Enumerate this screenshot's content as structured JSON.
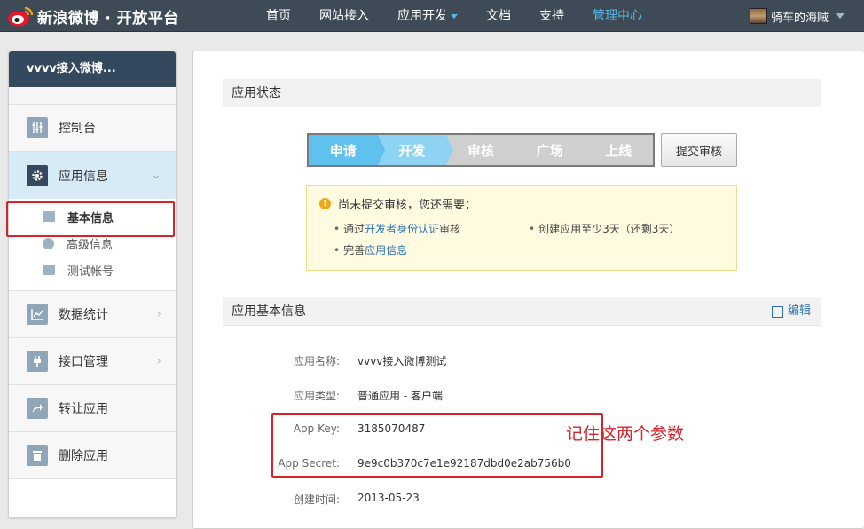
{
  "topbar": {
    "logo_text": "新浪微博 · 开放平台",
    "nav": [
      {
        "label": "首页"
      },
      {
        "label": "网站接入"
      },
      {
        "label": "应用开发"
      },
      {
        "label": "文档"
      },
      {
        "label": "支持"
      },
      {
        "label": "管理中心"
      }
    ],
    "user_name": "骑车的海贼"
  },
  "sidebar": {
    "app_name": "vvvv接入微博...",
    "items": [
      {
        "label": "控制台",
        "icon": "dashboard-icon"
      },
      {
        "label": "应用信息",
        "icon": "gear-icon"
      },
      {
        "label": "数据统计",
        "icon": "chart-icon"
      },
      {
        "label": "接口管理",
        "icon": "plug-icon"
      },
      {
        "label": "转让应用",
        "icon": "share-icon"
      },
      {
        "label": "删除应用",
        "icon": "trash-icon"
      }
    ],
    "sub_items": [
      {
        "label": "基本信息",
        "icon": "card-icon"
      },
      {
        "label": "高级信息",
        "icon": "alert-icon"
      },
      {
        "label": "测试帐号",
        "icon": "user-card-icon"
      }
    ]
  },
  "main": {
    "status_title": "应用状态",
    "steps": [
      {
        "label": "申请",
        "state": "done"
      },
      {
        "label": "开发",
        "state": "current"
      },
      {
        "label": "审核",
        "state": "pending"
      },
      {
        "label": "广场",
        "state": "pending"
      },
      {
        "label": "上线",
        "state": "pending"
      }
    ],
    "submit_label": "提交审核",
    "notice": {
      "title": "尚未提交审核，您还需要：",
      "line1_prefix": "通过",
      "line1_link": "开发者身份认证",
      "line1_suffix": "审核",
      "line2": "创建应用至少3天（还剩3天）",
      "line3_prefix": "完善",
      "line3_link": "应用信息"
    },
    "basic_title": "应用基本信息",
    "edit_label": "编辑",
    "fields": {
      "app_name_label": "应用名称:",
      "app_name": "vvvv接入微博测试",
      "app_type_label": "应用类型:",
      "app_type": "普通应用 - 客户端",
      "app_key_label": "App Key:",
      "app_key": "3185070487",
      "app_secret_label": "App Secret:",
      "app_secret": "9e9c0b370c7e1e92187dbd0e2ab756b0",
      "created_label": "创建时间:",
      "created": "2013-05-23"
    },
    "annotation": "记住这两个参数"
  },
  "colors": {
    "topbar_bg": "#3e4b56",
    "accent": "#5ab4e8",
    "highlight_red": "#d9232a",
    "link": "#2a6fb3"
  }
}
